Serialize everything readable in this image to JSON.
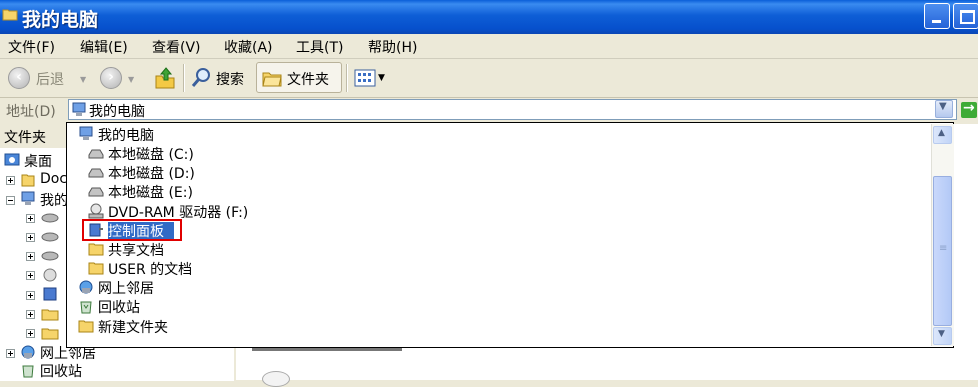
{
  "window": {
    "title": "我的电脑"
  },
  "menu": [
    "文件(F)",
    "编辑(E)",
    "查看(V)",
    "收藏(A)",
    "工具(T)",
    "帮助(H)"
  ],
  "toolbar": {
    "back": "后退",
    "search": "搜索",
    "folders": "文件夹"
  },
  "address": {
    "label": "地址(D)",
    "value": "我的电脑"
  },
  "left_pane": {
    "header": "文件夹",
    "tree": [
      "桌面",
      "Doc",
      "我的",
      "网上邻居",
      "回收站"
    ]
  },
  "dropdown": {
    "items": [
      {
        "label": "我的电脑",
        "icon": "computer-icon"
      },
      {
        "label": "本地磁盘 (C:)",
        "icon": "drive-icon"
      },
      {
        "label": "本地磁盘 (D:)",
        "icon": "drive-icon"
      },
      {
        "label": "本地磁盘 (E:)",
        "icon": "drive-icon"
      },
      {
        "label": "DVD-RAM 驱动器 (F:)",
        "icon": "dvd-drive-icon"
      },
      {
        "label": "控制面板",
        "icon": "control-panel-icon"
      },
      {
        "label": "共享文档",
        "icon": "folder-icon"
      },
      {
        "label": "USER 的文档",
        "icon": "folder-icon"
      },
      {
        "label": "网上邻居",
        "icon": "network-icon"
      },
      {
        "label": "回收站",
        "icon": "recycle-bin-icon"
      },
      {
        "label": "新建文件夹",
        "icon": "folder-icon"
      }
    ],
    "selected": "控制面板"
  },
  "colors": {
    "titlebar": "#0a5fd8",
    "selection": "#316ac5",
    "highlight_border": "#e00000"
  }
}
